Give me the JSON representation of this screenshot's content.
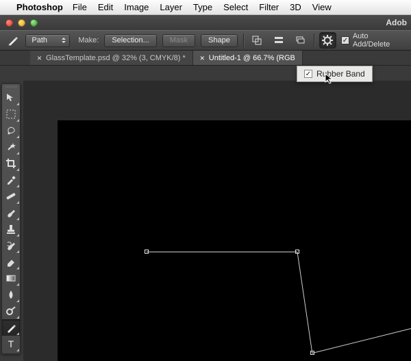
{
  "mac_menu": {
    "app": "Photoshop",
    "items": [
      "File",
      "Edit",
      "Image",
      "Layer",
      "Type",
      "Select",
      "Filter",
      "3D",
      "View"
    ]
  },
  "titlebar": {
    "app_short": "Adob"
  },
  "options_bar": {
    "mode_value": "Path",
    "make_label": "Make:",
    "selection_btn": "Selection...",
    "mask_btn": "Mask",
    "shape_btn": "Shape",
    "auto_add_delete": "Auto Add/Delete",
    "gear_menu": {
      "rubber_band": "Rubber Band"
    }
  },
  "doc_tabs": [
    {
      "label": "GlassTemplate.psd @ 32% (3, CMYK/8) *",
      "active": false
    },
    {
      "label": "Untitled-1 @ 66.7% (RGB",
      "active": true
    }
  ],
  "tools": [
    "move",
    "marquee",
    "lasso",
    "magic-wand",
    "crop",
    "eyedropper",
    "healing-brush",
    "brush",
    "clone-stamp",
    "history-brush",
    "eraser",
    "gradient",
    "blur",
    "pen",
    "type"
  ],
  "selected_tool_index": 13
}
